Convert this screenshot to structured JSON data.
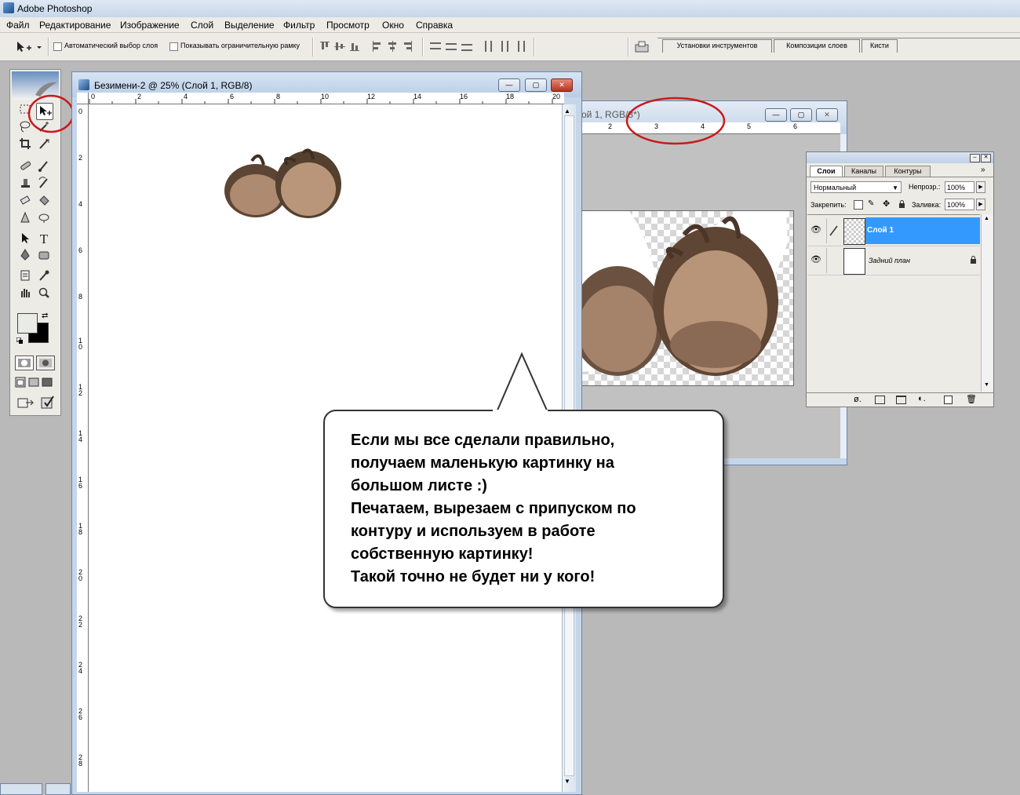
{
  "app": {
    "title": "Adobe Photoshop"
  },
  "menu": [
    "Файл",
    "Редактирование",
    "Изображение",
    "Слой",
    "Выделение",
    "Фильтр",
    "Просмотр",
    "Окно",
    "Справка"
  ],
  "options": {
    "auto_select": "Автоматический выбор слоя",
    "show_bounds": "Показывать ограничительную рамку",
    "palette_tabs": [
      "Установки инструментов",
      "Композиции слоев",
      "Кисти"
    ]
  },
  "doc1": {
    "title": "Безимени-2 @ 25% (Слой 1, RGB/8)",
    "ruler_h": [
      "0",
      "2",
      "4",
      "6",
      "8",
      "10",
      "12",
      "14",
      "16",
      "18",
      "20"
    ],
    "ruler_v": [
      "0",
      "2",
      "4",
      "6",
      "8",
      "1 0",
      "1 2",
      "1 4",
      "1 6",
      "1 8",
      "2 0",
      "2 2",
      "2 4",
      "2 6",
      "2 8"
    ]
  },
  "doc2": {
    "title": "ой 1, RGB/8*)",
    "ruler_h": [
      "2",
      "3",
      "4",
      "5",
      "6"
    ]
  },
  "layers_panel": {
    "tabs": [
      "Слои",
      "Каналы",
      "Контуры"
    ],
    "blend_mode": "Нормальный",
    "opacity_label": "Непрозр.:",
    "opacity": "100%",
    "lock_label": "Закрепить:",
    "fill_label": "Заливка:",
    "fill": "100%",
    "layers": [
      {
        "name": "Слой 1"
      },
      {
        "name": "Задний план"
      }
    ]
  },
  "callout": {
    "lines": [
      "Если мы все сделали правильно,",
      "получаем маленькую картинку на",
      "большом листе :)",
      "Печатаем, вырезаем с припуском по",
      "контуру и используем в работе",
      "собственную картинку!",
      "Такой точно не будет ни у кого!"
    ]
  }
}
